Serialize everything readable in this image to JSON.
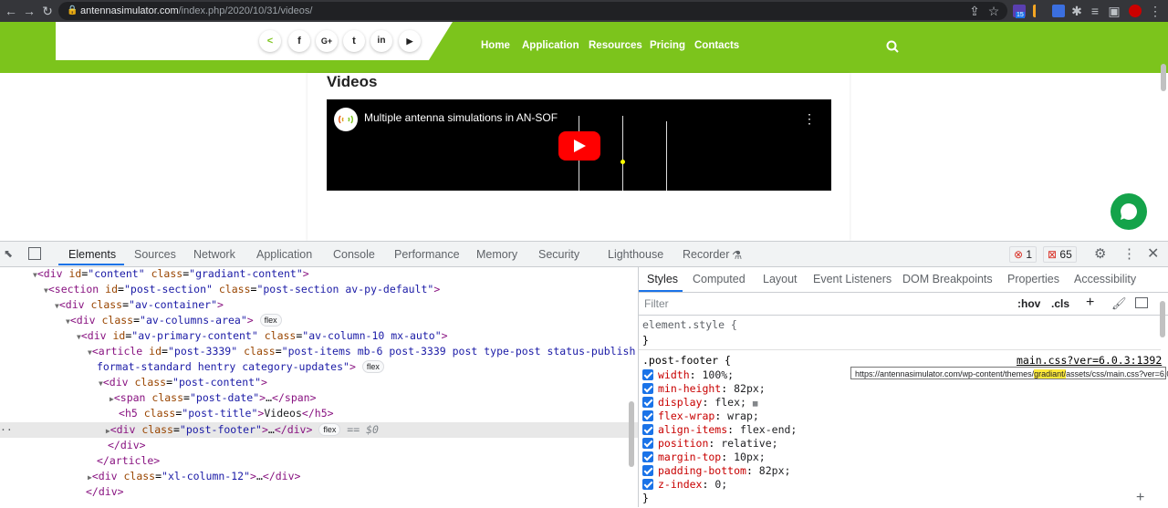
{
  "browser": {
    "url_host": "antennasimulator.com",
    "url_path": "/index.php/2020/10/31/videos/",
    "extension_badge": "15"
  },
  "site": {
    "nav": [
      "Home",
      "Application",
      "Resources",
      "Pricing",
      "Contacts"
    ],
    "social_icons": [
      "share-icon",
      "facebook-icon",
      "google-plus-icon",
      "twitter-icon",
      "linkedin-icon",
      "youtube-icon"
    ],
    "accent_color": "#7cc41c"
  },
  "page": {
    "title": "Videos",
    "video_title": "Multiple antenna simulations in AN-SOF"
  },
  "devtools": {
    "tabs": [
      "Elements",
      "Sources",
      "Network",
      "Application",
      "Console",
      "Performance",
      "Memory",
      "Security",
      "Lighthouse",
      "Recorder"
    ],
    "active_tab": "Elements",
    "errors": "1",
    "issues": "65",
    "styles_tabs": [
      "Styles",
      "Computed",
      "Layout",
      "Event Listeners",
      "DOM Breakpoints",
      "Properties",
      "Accessibility"
    ],
    "filter_placeholder": "Filter",
    "hov": ":hov",
    "cls": ".cls",
    "element_style": "element.style {",
    "close_brace": "}",
    "rule_selector": ".post-footer {",
    "rule_source": "main.css?ver=6.0.3:1392",
    "tooltip_before": "https://antennasimulator.com/wp-content/themes/",
    "tooltip_highlight": "gradiant/",
    "tooltip_after": "assets/css/main.css?ver=6.0.3:1392",
    "css_props": [
      {
        "name": "width",
        "value": "100%;"
      },
      {
        "name": "min-height",
        "value": "82px;"
      },
      {
        "name": "display",
        "value": "flex;"
      },
      {
        "name": "flex-wrap",
        "value": "wrap;"
      },
      {
        "name": "align-items",
        "value": "flex-end;"
      },
      {
        "name": "position",
        "value": "relative;"
      },
      {
        "name": "margin-top",
        "value": "10px;"
      },
      {
        "name": "padding-bottom",
        "value": "82px;"
      },
      {
        "name": "z-index",
        "value": "0;"
      }
    ],
    "dom": {
      "l1": {
        "tag": "div",
        "id": "content",
        "class": "gradiant-content"
      },
      "l2": {
        "tag": "section",
        "id": "post-section",
        "class": "post-section av-py-default"
      },
      "l3": {
        "tag": "div",
        "class": "av-container"
      },
      "l4": {
        "tag": "div",
        "class": "av-columns-area"
      },
      "l5": {
        "tag": "div",
        "id": "av-primary-content",
        "class": "av-column-10 mx-auto"
      },
      "l6": {
        "tag": "article",
        "id": "post-3339",
        "class": "post-items mb-6 post-3339 post type-post status-publish",
        "class2": "format-standard hentry category-updates"
      },
      "l7": {
        "tag": "div",
        "class": "post-content"
      },
      "l8": {
        "tag": "span",
        "class": "post-date"
      },
      "l9": {
        "tag": "h5",
        "class": "post-title",
        "text": "Videos"
      },
      "l10": {
        "tag": "div",
        "class": "post-footer"
      },
      "l13": {
        "tag": "div",
        "class": "xl-column-12"
      },
      "flex_label": "flex",
      "dollar0": "== $0",
      "ellipsis": "…",
      "close_div": "</div>",
      "close_article": "</article>",
      "close_div2": "</div>"
    }
  }
}
